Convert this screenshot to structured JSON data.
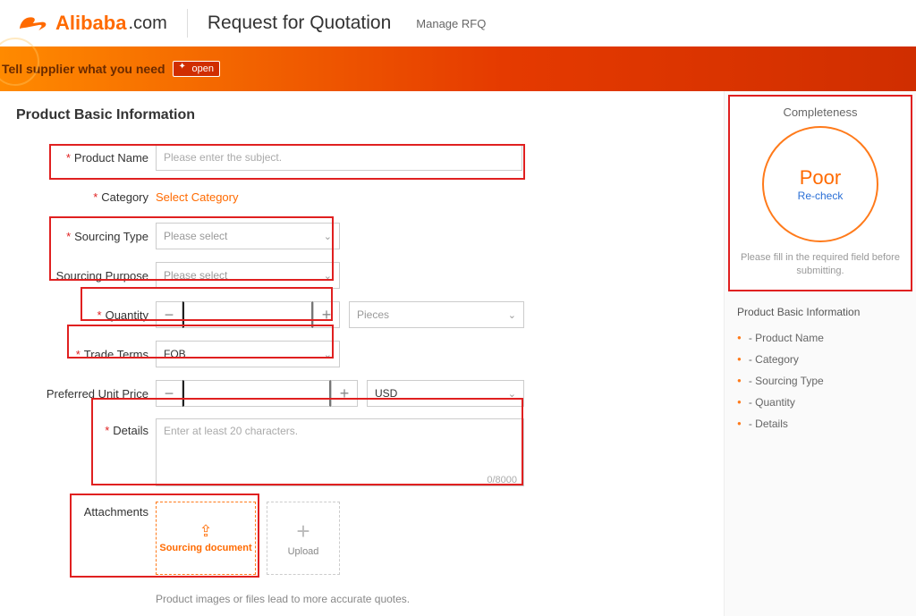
{
  "header": {
    "logo_text": "Alibaba",
    "logo_suffix": ".com",
    "page_title": "Request for Quotation",
    "manage_link": "Manage RFQ"
  },
  "banner": {
    "prompt": "Tell supplier what you need",
    "badge": "open"
  },
  "section": {
    "title": "Product Basic Information"
  },
  "form": {
    "product_name": {
      "label": "Product Name",
      "placeholder": "Please enter the subject."
    },
    "category": {
      "label": "Category",
      "action": "Select Category"
    },
    "sourcing_type": {
      "label": "Sourcing Type",
      "placeholder": "Please select"
    },
    "sourcing_purpose": {
      "label": "Sourcing Purpose",
      "placeholder": "Please select"
    },
    "quantity": {
      "label": "Quantity",
      "unit_placeholder": "Pieces"
    },
    "trade_terms": {
      "label": "Trade Terms",
      "value": "FOB"
    },
    "unit_price": {
      "label": "Preferred Unit Price",
      "currency": "USD"
    },
    "details": {
      "label": "Details",
      "placeholder": "Enter at least 20 characters.",
      "counter": "0/8000"
    },
    "attachments": {
      "label": "Attachments",
      "sourcing_doc": "Sourcing document",
      "upload": "Upload",
      "hint": "Product images or files lead to more accurate quotes."
    }
  },
  "sidebar": {
    "completeness": {
      "title": "Completeness",
      "status": "Poor",
      "recheck": "Re-check",
      "hint": "Please fill in the required field before submitting."
    },
    "section_title": "Product Basic Information",
    "items": [
      "- Product Name",
      "- Category",
      "- Sourcing Type",
      "- Quantity",
      "- Details"
    ]
  }
}
